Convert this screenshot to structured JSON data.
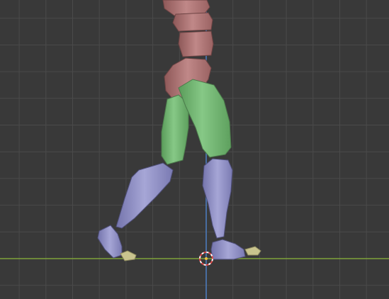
{
  "viewport": {
    "view": "3D Viewport",
    "background_color": "#393939",
    "grid_color": "#4a4a4a",
    "x_axis_color": "#7fa33a",
    "z_axis_color": "#4d7fc4",
    "cursor_color": "#e04848"
  },
  "rig": {
    "torso_color": "#b07474",
    "thigh_color": "#6fb26f",
    "shin_color": "#8a8ac0",
    "toe_color": "#c9c48e"
  },
  "icons": {
    "cursor": "3d-cursor-icon"
  }
}
